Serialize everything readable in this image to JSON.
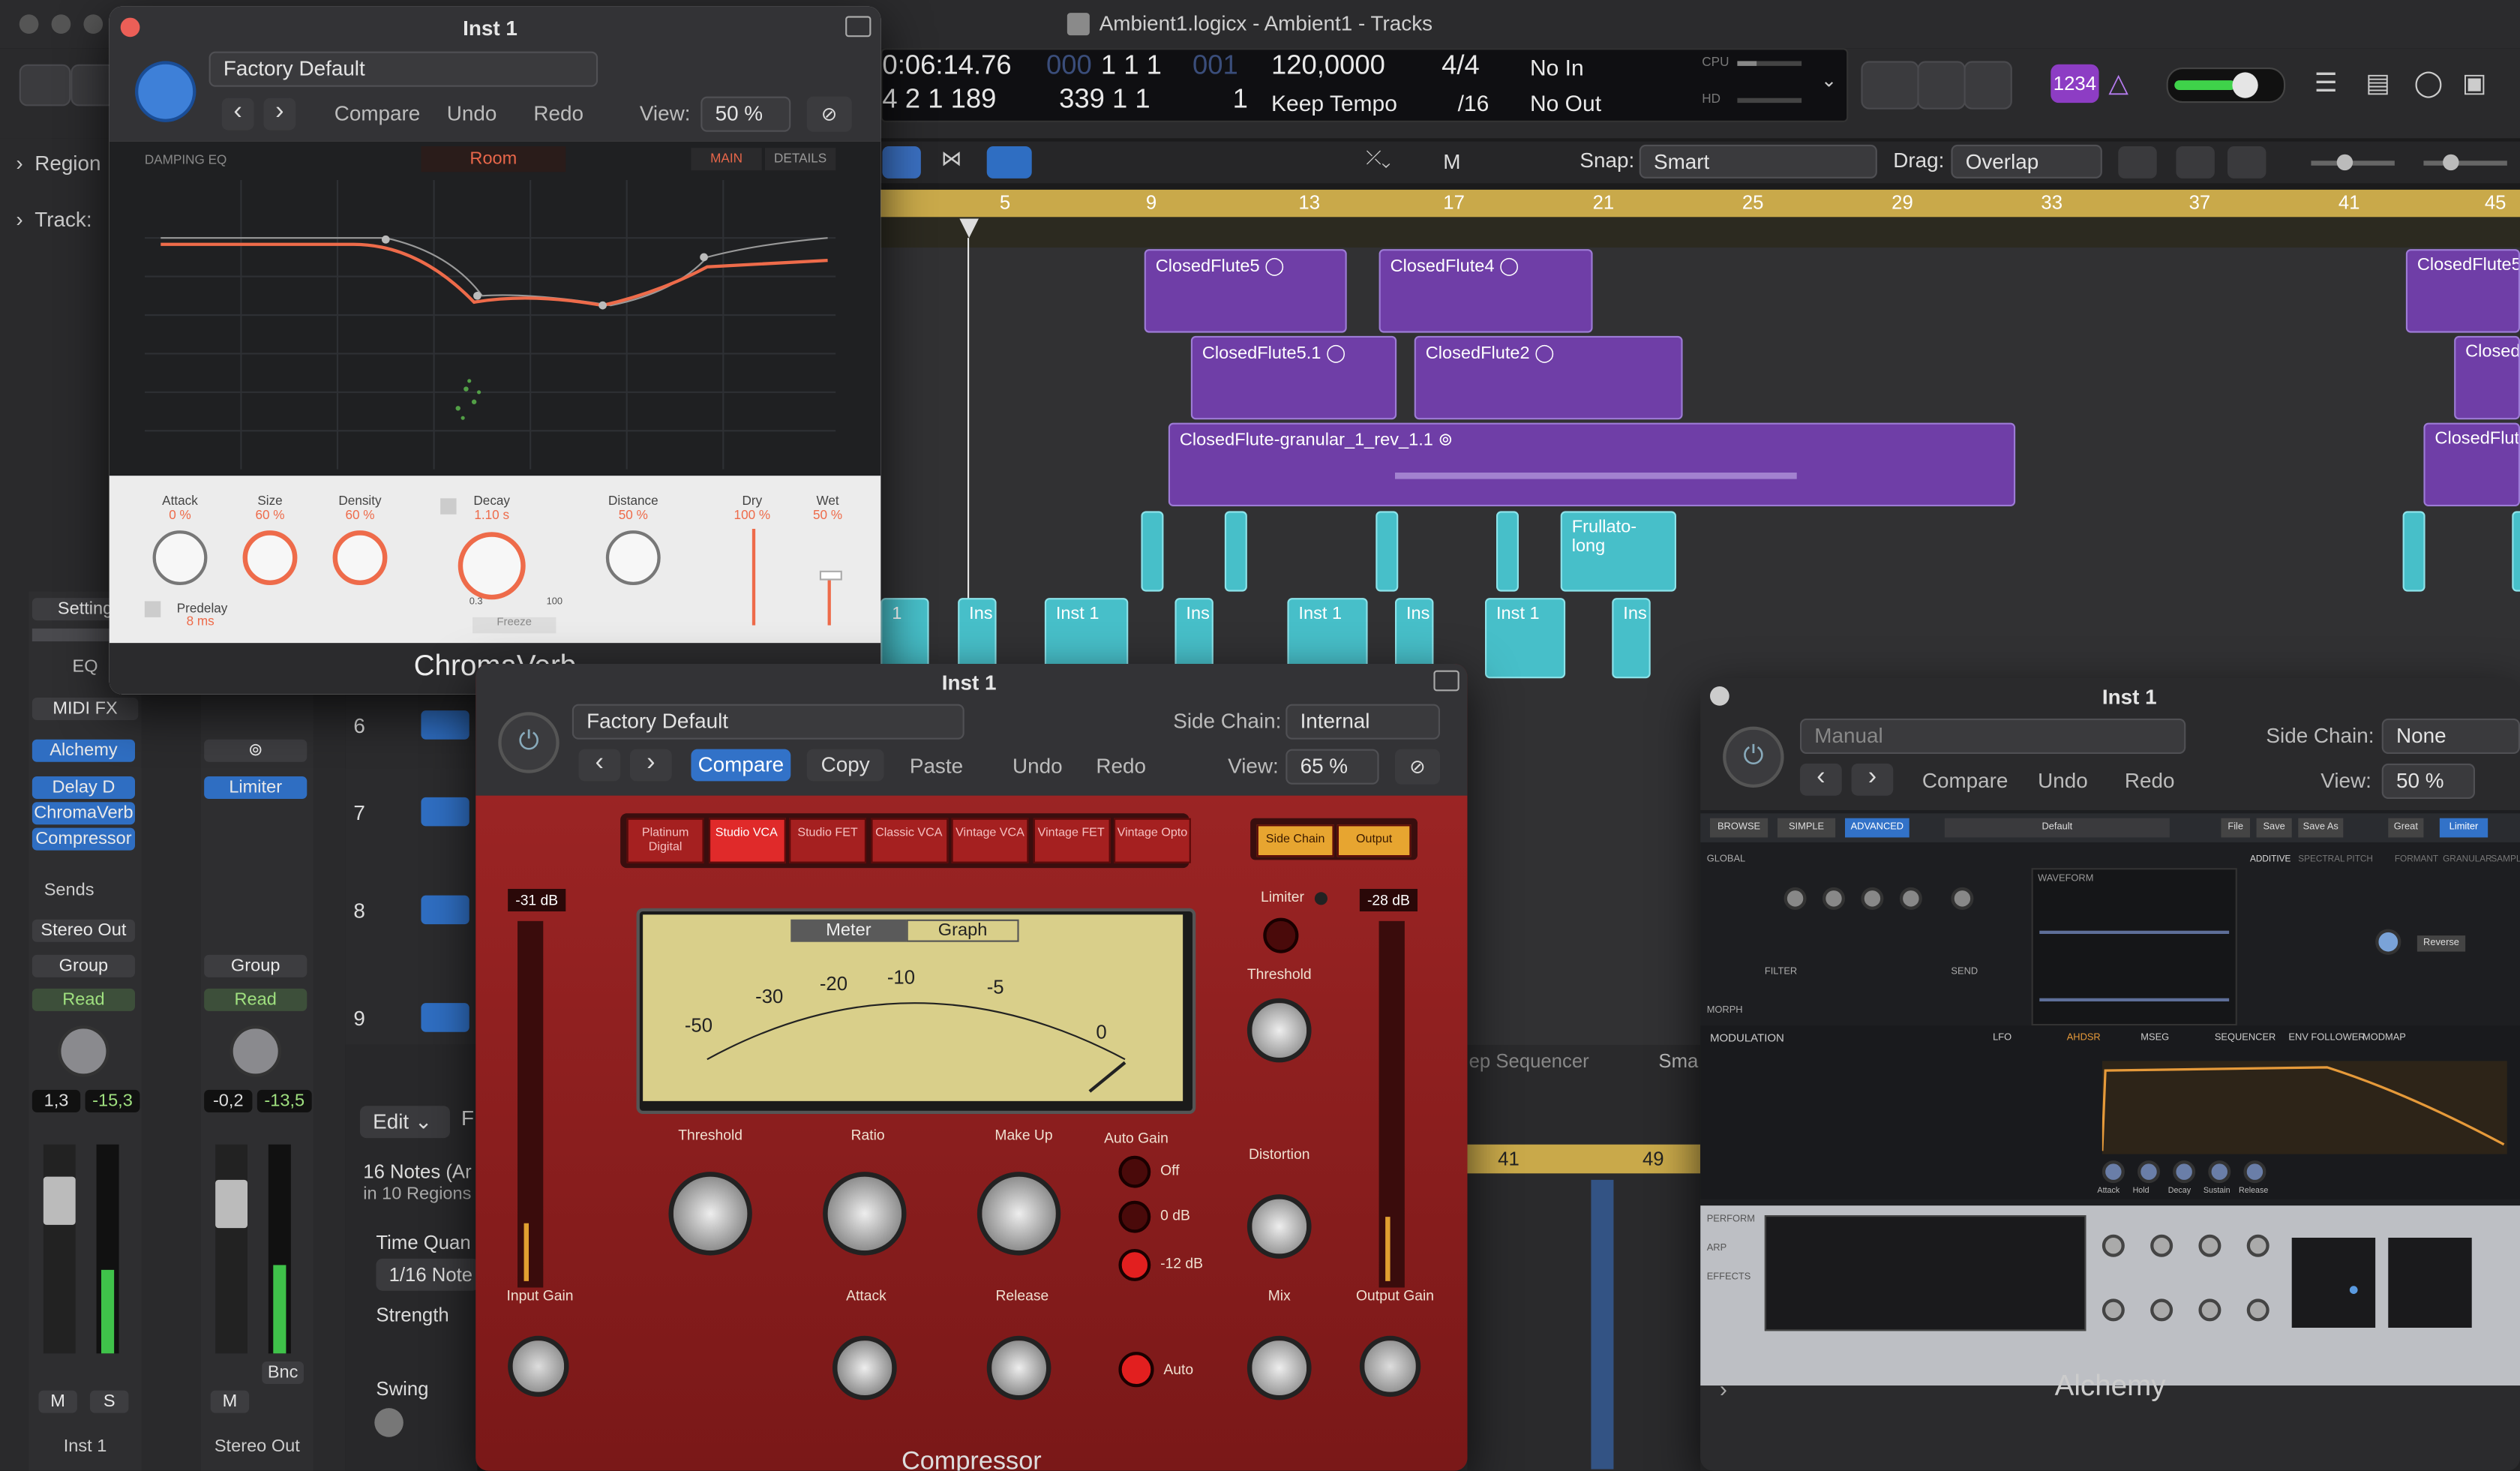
{
  "window": {
    "title": "Ambient1.logicx - Ambient1 - Tracks"
  },
  "lcd": {
    "time": "0:06:14.76",
    "bars1": "1  1  1",
    "bars1_dim": "000",
    "bars1_tick": "001",
    "tempo": "120,0000",
    "sig": "4/4",
    "in": "No In",
    "pos2": "4  2  1  189",
    "pos3": "339  1  1",
    "pos3_tick": "1",
    "tempo_mode": "Keep Tempo",
    "division": "/16",
    "out": "No Out",
    "cpu": "CPU",
    "hd": "HD"
  },
  "toolbar": {
    "snap_label": "Snap:",
    "snap_value": "Smart",
    "drag_label": "Drag:",
    "drag_value": "Overlap",
    "counter_badge": "1234",
    "m_label": "M"
  },
  "ruler": {
    "marks": [
      "5",
      "9",
      "13",
      "17",
      "21",
      "25",
      "29",
      "33",
      "37",
      "41",
      "45"
    ]
  },
  "regions": {
    "purple": [
      {
        "name": "ClosedFlute5"
      },
      {
        "name": "ClosedFlute4"
      },
      {
        "name": "ClosedFlute5.1"
      },
      {
        "name": "ClosedFlute2"
      },
      {
        "name": "ClosedFlute-granular_1_rev_1.1"
      },
      {
        "name": "ClosedFlute5"
      },
      {
        "name": "Closed"
      },
      {
        "name": "ClosedFlute"
      }
    ],
    "cyan": [
      {
        "name": "Frullato-long"
      },
      {
        "name": "1"
      },
      {
        "name": "Ins"
      },
      {
        "name": "Inst 1"
      },
      {
        "name": "Ins"
      },
      {
        "name": "Inst 1"
      },
      {
        "name": "Ins"
      },
      {
        "name": "Inst 1"
      },
      {
        "name": "Ins"
      }
    ]
  },
  "inspector": {
    "region": "Region",
    "track": "Track:",
    "setting": "Setting",
    "eq": "EQ",
    "midi_fx": "MIDI FX",
    "inst": "Alchemy",
    "fx1": "Delay D",
    "fx2": "ChromaVerb",
    "fx3": "Compressor",
    "limiter": "Limiter",
    "sends": "Sends",
    "output": "Stereo Out",
    "group": "Group",
    "read": "Read",
    "vol1": "1,3",
    "peak1": "-15,3",
    "vol2": "-0,2",
    "peak2": "-13,5",
    "m": "M",
    "s": "S",
    "bnc": "Bnc",
    "ch1": "Inst 1",
    "ch2": "Stereo Out"
  },
  "tracklist": {
    "numbers": [
      "6",
      "7",
      "8",
      "9"
    ]
  },
  "editor": {
    "edit": "Edit",
    "f": "F",
    "notes": "16 Notes (Ar",
    "regions": "in 10 Regions",
    "time_quant": "Time Quan",
    "quant_value": "1/16 Note",
    "strength": "Strength",
    "swing": "Swing",
    "step_seq": "ep Sequencer",
    "sma": "Sma",
    "bars": [
      "41",
      "49"
    ]
  },
  "chromaverb": {
    "title": "Inst 1",
    "preset": "Factory Default",
    "compare": "Compare",
    "undo": "Undo",
    "redo": "Redo",
    "view_label": "View:",
    "view": "50 %",
    "damping": "DAMPING EQ",
    "room": "Room",
    "main": "MAIN",
    "details": "DETAILS",
    "knobs": [
      {
        "label": "Attack",
        "value": "0 %"
      },
      {
        "label": "Size",
        "value": "60 %"
      },
      {
        "label": "Density",
        "value": "60 %"
      },
      {
        "label": "Decay",
        "value": "1.10 s"
      },
      {
        "label": "Distance",
        "value": "50 %"
      },
      {
        "label": "Dry",
        "value": "100 %"
      },
      {
        "label": "Wet",
        "value": "50 %"
      }
    ],
    "predelay": "Predelay",
    "predelay_val": "8 ms",
    "decay_min": "0.3",
    "decay_max": "100",
    "freeze": "Freeze",
    "name": "ChromaVerb"
  },
  "compressor": {
    "title": "Inst 1",
    "preset": "Factory Default",
    "sidechain_label": "Side Chain:",
    "sidechain": "Internal",
    "compare": "Compare",
    "copy": "Copy",
    "paste": "Paste",
    "undo": "Undo",
    "redo": "Redo",
    "view_label": "View:",
    "view": "65 %",
    "types": [
      "Platinum Digital",
      "Studio VCA",
      "Studio FET",
      "Classic VCA",
      "Vintage VCA",
      "Vintage FET",
      "Vintage Opto"
    ],
    "sc_btn": "Side Chain",
    "out_btn": "Output",
    "in_db": "-31 dB",
    "out_db": "-28 dB",
    "meter": "Meter",
    "graph": "Graph",
    "scale": [
      "-50",
      "-30",
      "-20",
      "-10",
      "-5",
      "0"
    ],
    "threshold": "Threshold",
    "ratio": "Ratio",
    "makeup": "Make Up",
    "autogain": "Auto Gain",
    "attack": "Attack",
    "release": "Release",
    "mix": "Mix",
    "limiter": "Limiter",
    "distortion": "Distortion",
    "input_gain": "Input Gain",
    "output_gain": "Output Gain",
    "ag_off": "Off",
    "ag_0": "0 dB",
    "ag_12": "-12 dB",
    "auto": "Auto",
    "name": "Compressor"
  },
  "alchemy": {
    "title": "Inst 1",
    "preset": "Manual",
    "sidechain_label": "Side Chain:",
    "sidechain": "None",
    "compare": "Compare",
    "undo": "Undo",
    "redo": "Redo",
    "view_label": "View:",
    "view": "50 %",
    "tabs": [
      "BROWSE",
      "SIMPLE",
      "ADVANCED"
    ],
    "preset_name": "Default",
    "file": "File",
    "save": "Save",
    "saveas": "Save As",
    "quality": "Great",
    "limiter": "Limiter",
    "sections": [
      "ADDITIVE",
      "SPECTRAL",
      "PITCH",
      "FORMANT",
      "GRANULAR",
      "SAMPLE"
    ],
    "global": "GLOBAL",
    "morph": "MORPH",
    "filter": "FILTER",
    "send": "SEND",
    "waveform": "WAVEFORM",
    "modulation": "MODULATION",
    "modtabs": [
      "LFO",
      "AHDSR",
      "MSEG",
      "SEQUENCER",
      "ENV FOLLOWER",
      "MODMAP"
    ],
    "env": [
      "Attack",
      "Hold",
      "Decay",
      "Sustain",
      "Release"
    ],
    "perform": "PERFORM",
    "arp": "ARP",
    "effects": "EFFECTS",
    "reverse": "Reverse",
    "name": "Alchemy"
  }
}
